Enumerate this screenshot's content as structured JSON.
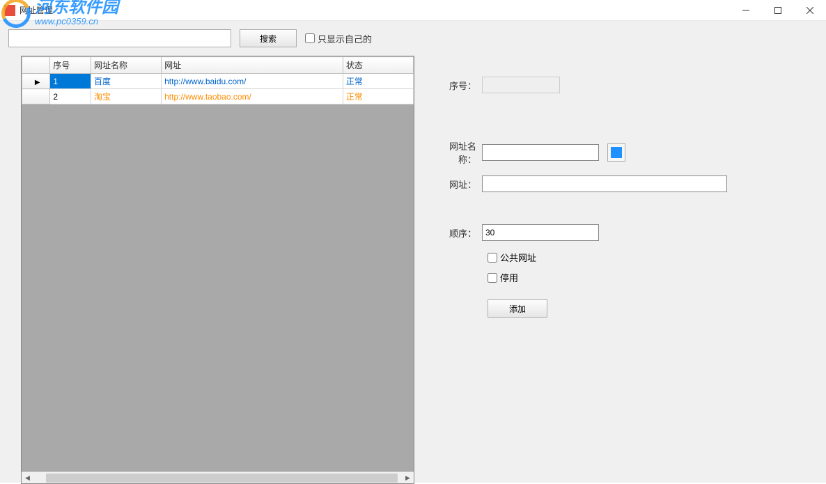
{
  "window": {
    "title": "网址管理"
  },
  "toolbar": {
    "search_value": "",
    "search_btn": "搜索",
    "only_mine": "只显示自己的"
  },
  "grid": {
    "headers": {
      "seq": "序号",
      "name": "网址名称",
      "url": "网址",
      "status": "状态"
    },
    "rows": [
      {
        "seq": "1",
        "name": "百度",
        "url": "http://www.baidu.com/",
        "status": "正常",
        "color": "blue",
        "selected": true
      },
      {
        "seq": "2",
        "name": "淘宝",
        "url": "http://www.taobao.com/",
        "status": "正常",
        "color": "orange",
        "selected": false
      }
    ]
  },
  "form": {
    "seq_label": "序号：",
    "seq_value": "",
    "name_label": "网址名称：",
    "name_value": "",
    "url_label": "网址：",
    "url_value": "",
    "order_label": "顺序：",
    "order_value": "30",
    "public_label": "公共网址",
    "disabled_label": "停用",
    "add_btn": "添加"
  },
  "watermark": {
    "line1": "河东软件园",
    "line2": "www.pc0359.cn"
  }
}
